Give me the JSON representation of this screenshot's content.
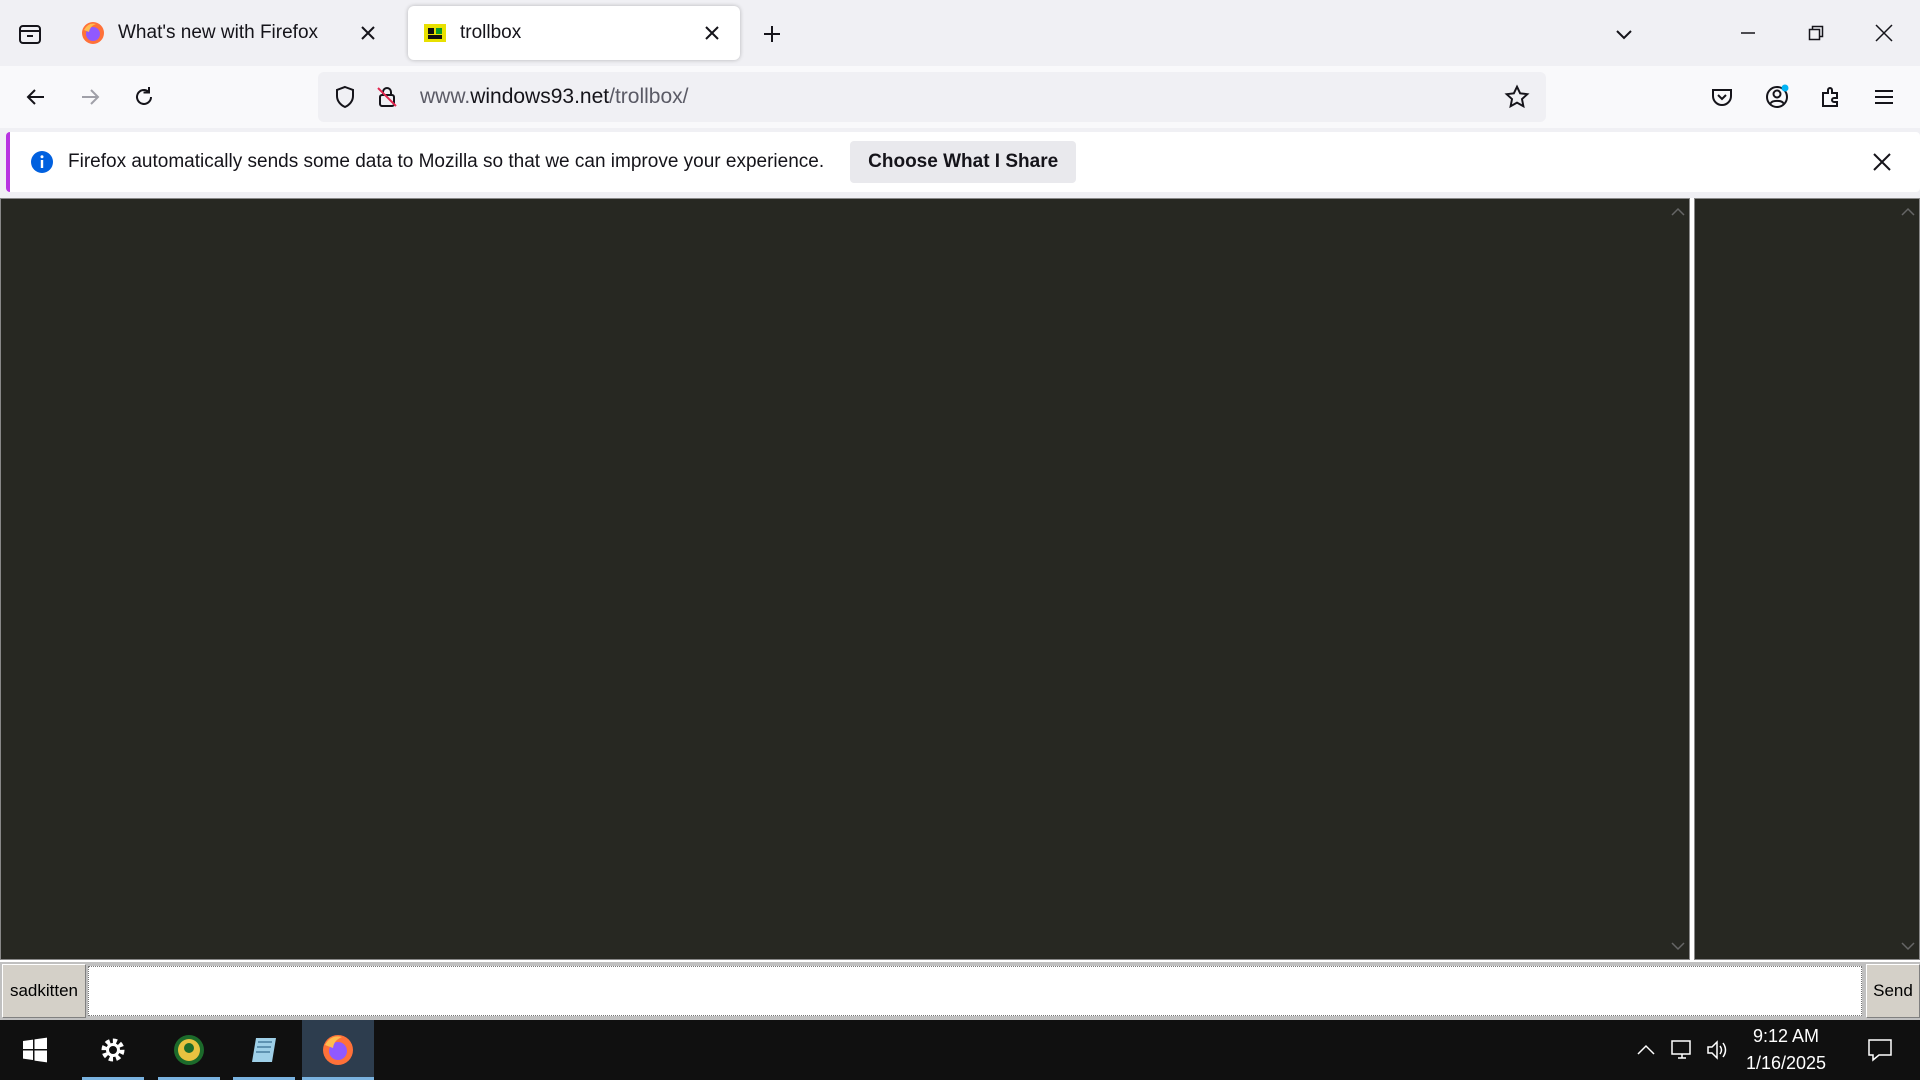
{
  "browser": {
    "tabs": [
      {
        "title": "What's new with Firefox",
        "active": false,
        "favicon": "firefox-logo"
      },
      {
        "title": "trollbox",
        "active": true,
        "favicon": "windows93-logo"
      }
    ],
    "url": {
      "prefix": "www.",
      "host": "windows93.net",
      "path": "/trollbox/"
    },
    "notification": {
      "message": "Firefox automatically sends some data to Mozilla so that we can improve your experience.",
      "button_label": "Choose What I Share"
    }
  },
  "trollbox": {
    "nickname": "sadkitten",
    "input_value": "",
    "send_label": "Send",
    "colors": {
      "chat_bg": "#272822",
      "panel_bg": "#c0c0c0"
    }
  },
  "taskbar": {
    "apps": [
      "start-button",
      "settings-icon",
      "spin-app-icon",
      "notebook-app-icon",
      "firefox-icon"
    ],
    "time": "9:12 AM",
    "date": "1/16/2025"
  }
}
